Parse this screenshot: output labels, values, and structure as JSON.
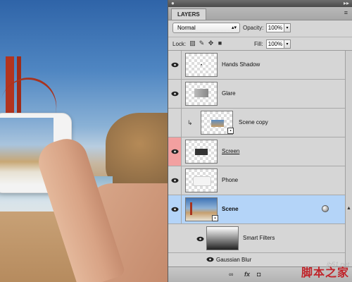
{
  "panel": {
    "tab_label": "LAYERS",
    "blend_mode": "Normal",
    "opacity_label": "Opacity:",
    "opacity_value": "100%",
    "lock_label": "Lock:",
    "fill_label": "Fill:",
    "fill_value": "100%"
  },
  "layers": [
    {
      "name": "Hands Shadow",
      "thumb": "transparent-shadow",
      "visible": true
    },
    {
      "name": "Glare",
      "thumb": "transparent-glare",
      "visible": true
    },
    {
      "name": "Scene copy",
      "thumb": "scene",
      "clipped": true,
      "visible": false
    },
    {
      "name": "Screen",
      "thumb": "dark-rect",
      "visible": true,
      "eye_color": "#f2a0a0"
    },
    {
      "name": "Phone",
      "thumb": "transparent-phone",
      "visible": true
    },
    {
      "name": "Scene",
      "thumb": "scene",
      "selected": true,
      "visible": true
    },
    {
      "name": "Smart Filters",
      "thumb": "gradient-mask",
      "sub": true
    },
    {
      "name": "Gaussian Blur",
      "sub": true
    }
  ],
  "watermark": {
    "site": "jb51.net",
    "brand": "脚本之家"
  },
  "colors": {
    "selected_row": "#b4d4f8",
    "eye_highlight": "#f2a0a0"
  }
}
